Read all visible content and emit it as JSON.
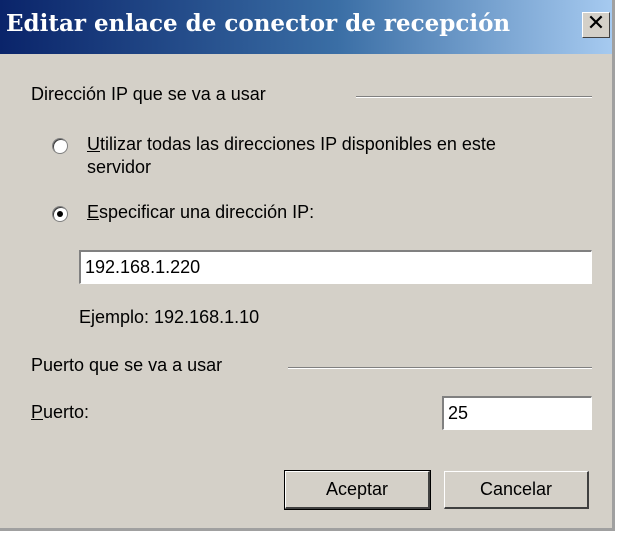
{
  "window": {
    "title": "Editar enlace de conector de recepción",
    "close_glyph": "✕"
  },
  "ip_section": {
    "header": "Dirección IP que se va a usar",
    "option_all": {
      "accel": "U",
      "label_rest": "tilizar todas las direcciones IP disponibles en este",
      "label_line2": "servidor",
      "selected": false
    },
    "option_specific": {
      "accel": "E",
      "label_rest": "specificar una dirección IP:",
      "selected": true
    },
    "ip_value": "192.168.1.220",
    "example": "Ejemplo: 192.168.1.10"
  },
  "port_section": {
    "header": "Puerto que se va a usar",
    "port_label_accel": "P",
    "port_label_rest": "uerto:",
    "port_value": "25"
  },
  "buttons": {
    "ok": "Aceptar",
    "cancel": "Cancelar"
  }
}
